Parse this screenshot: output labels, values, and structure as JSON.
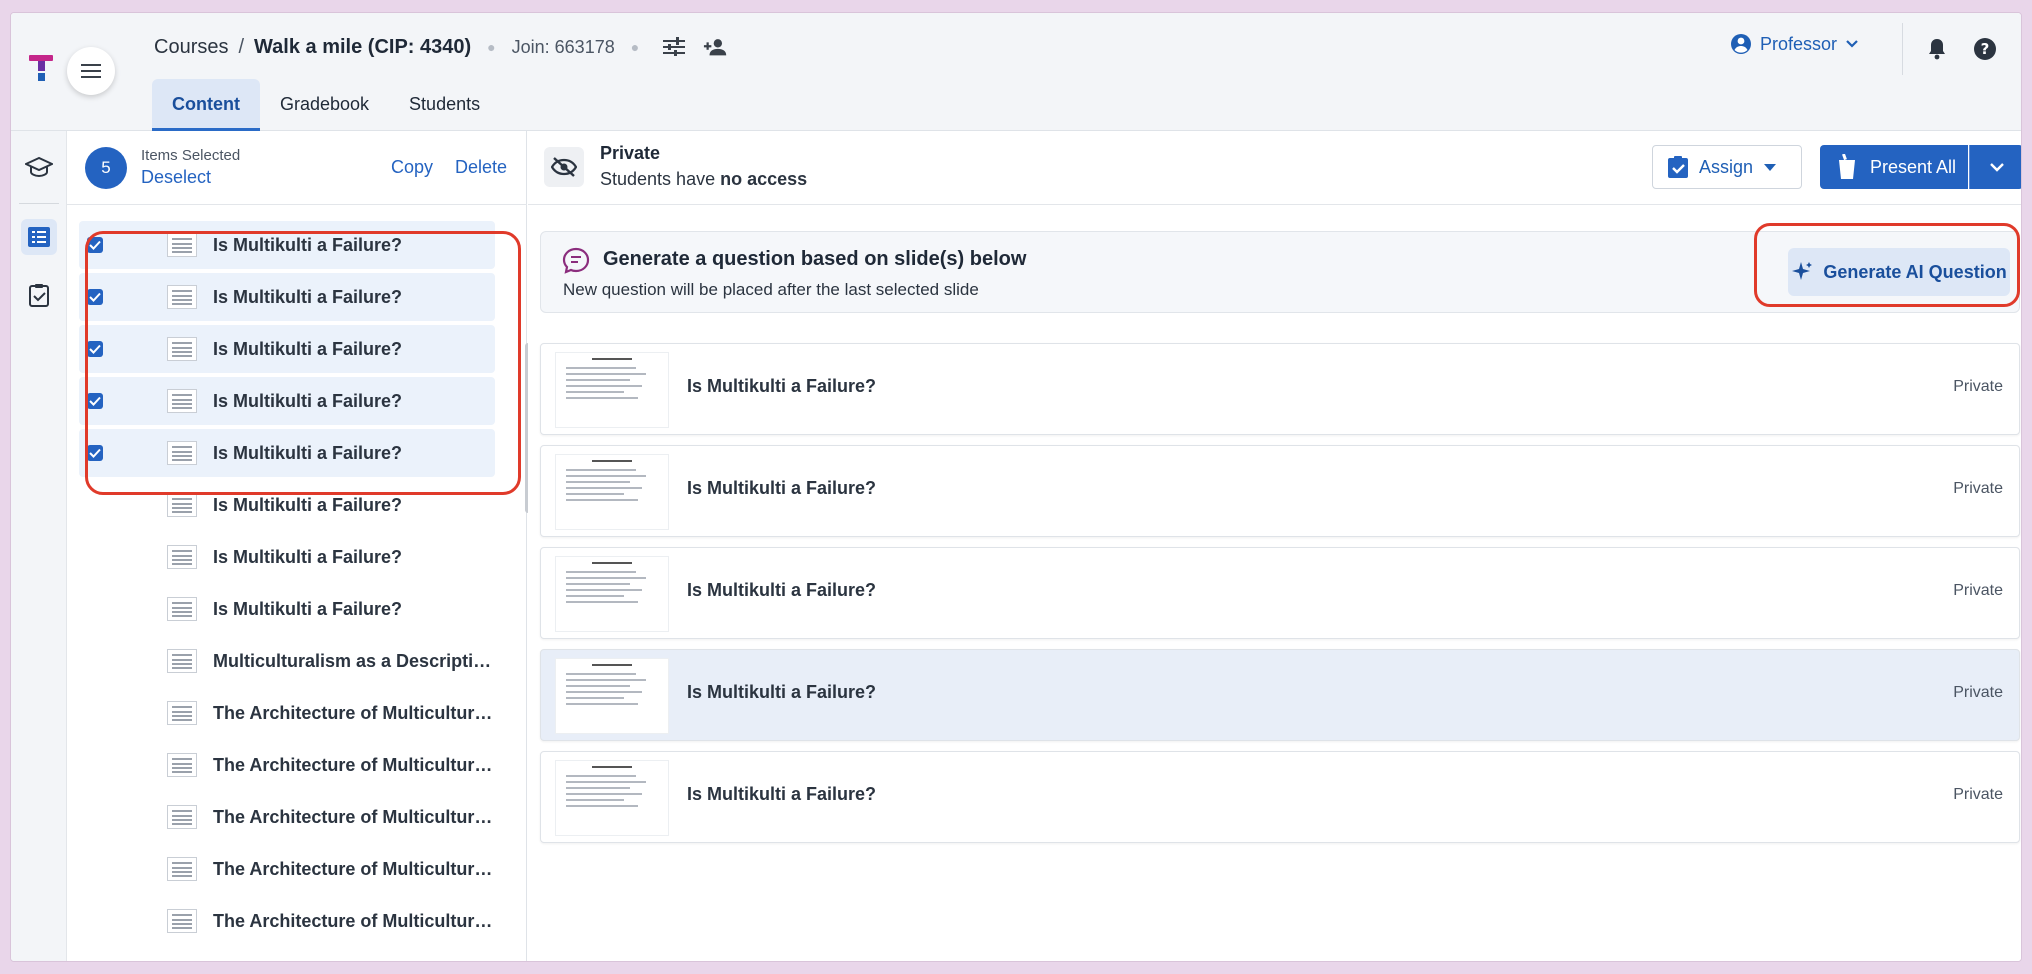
{
  "header": {
    "breadcrumb_root": "Courses",
    "breadcrumb_sep": "/",
    "course_title": "Walk a mile (CIP: 4340)",
    "join_code": "Join: 663178",
    "tabs": [
      "Content",
      "Gradebook",
      "Students"
    ],
    "role": "Professor"
  },
  "selection": {
    "count": "5",
    "label": "Items Selected",
    "deselect": "Deselect",
    "copy": "Copy",
    "delete": "Delete"
  },
  "slide_list": [
    {
      "title": "Is Multikulti a Failure?",
      "selected": true
    },
    {
      "title": "Is Multikulti a Failure?",
      "selected": true
    },
    {
      "title": "Is Multikulti a Failure?",
      "selected": true
    },
    {
      "title": "Is Multikulti a Failure?",
      "selected": true
    },
    {
      "title": "Is Multikulti a Failure?",
      "selected": true
    },
    {
      "title": "Is Multikulti a Failure?",
      "selected": false
    },
    {
      "title": "Is Multikulti a Failure?",
      "selected": false
    },
    {
      "title": "Is Multikulti a Failure?",
      "selected": false
    },
    {
      "title": "Multiculturalism as a Descriptiv...",
      "selected": false
    },
    {
      "title": "The Architecture of Multicultura...",
      "selected": false
    },
    {
      "title": "The Architecture of Multicultura...",
      "selected": false
    },
    {
      "title": "The Architecture of Multicultura...",
      "selected": false
    },
    {
      "title": "The Architecture of Multicultura...",
      "selected": false
    },
    {
      "title": "The Architecture of Multicultura...",
      "selected": false
    }
  ],
  "visibility": {
    "title": "Private",
    "sub_prefix": "Students have ",
    "sub_bold": "no access"
  },
  "actions": {
    "assign": "Assign",
    "present": "Present All"
  },
  "generate": {
    "title": "Generate a question based on slide(s) below",
    "subtitle": "New question will be placed after the last selected slide",
    "button": "Generate AI Question"
  },
  "slides": [
    {
      "title": "Is Multikulti a Failure?",
      "status": "Private",
      "highlight": false
    },
    {
      "title": "Is Multikulti a Failure?",
      "status": "Private",
      "highlight": false
    },
    {
      "title": "Is Multikulti a Failure?",
      "status": "Private",
      "highlight": false
    },
    {
      "title": "Is Multikulti a Failure?",
      "status": "Private",
      "highlight": true
    },
    {
      "title": "Is Multikulti a Failure?",
      "status": "Private",
      "highlight": false
    }
  ],
  "colors": {
    "primary": "#2463c1",
    "highlight_outline": "#e03a2a",
    "selected_row": "#ebf2fb"
  }
}
